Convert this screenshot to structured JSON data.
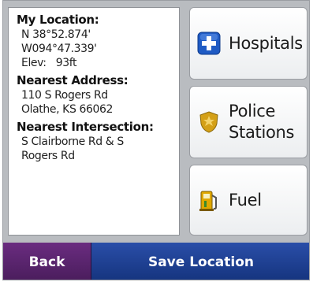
{
  "location": {
    "heading": "My Location:",
    "lat": "N 38°52.874'",
    "lon": "W094°47.339'",
    "elevation": "Elev:   93ft"
  },
  "address": {
    "heading": "Nearest Address:",
    "line1": "110 S Rogers Rd",
    "line2": "Olathe, KS 66062"
  },
  "intersection": {
    "heading": "Nearest Intersection:",
    "line1": "S Clairborne Rd & S",
    "line2": "Rogers Rd"
  },
  "categories": {
    "hospitals": {
      "label": "Hospitals",
      "icon": "hospital-cross-icon"
    },
    "police": {
      "label_line1": "Police",
      "label_line2": "Stations",
      "icon": "police-badge-icon"
    },
    "fuel": {
      "label": "Fuel",
      "icon": "fuel-pump-icon"
    }
  },
  "footer": {
    "back_label": "Back",
    "save_label": "Save Location"
  },
  "colors": {
    "back": "#5a2470",
    "save": "#1e3f94",
    "hospital_icon": "#1f5bc4",
    "badge": "#d4a017",
    "fuel": "#e0a800"
  }
}
